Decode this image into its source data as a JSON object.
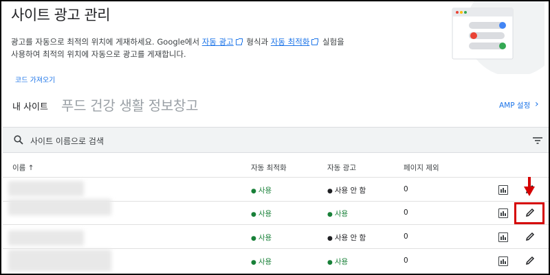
{
  "page": {
    "title": "사이트 광고 관리",
    "desc_part1": "광고를 자동으로 최적의 위치에 게재하세요. Google에서",
    "desc_link1": "자동 광고",
    "desc_part2": "형식과",
    "desc_link2": "자동 최적화",
    "desc_part3": "실험을",
    "desc_line2": "사용하여 최적의 위치에 자동으로 광고를 게재합니다.",
    "code_link": "코드 가져오기"
  },
  "mysite": {
    "label": "내 사이트",
    "site_name": "푸드 건강 생활 정보창고",
    "amp_link": "AMP 설정",
    "amp_chevron": "›"
  },
  "search": {
    "placeholder": "사이트 이름으로 검색"
  },
  "table": {
    "headers": [
      "이름 ↑",
      "자동 최적화",
      "자동 광고",
      "페이지 제외"
    ],
    "rows": [
      {
        "auto_opt": "사용",
        "auto_ads": "사용 안 함",
        "exclusions": "0"
      },
      {
        "auto_opt": "사용",
        "auto_ads": "사용",
        "exclusions": "0"
      },
      {
        "auto_opt": "사용",
        "auto_ads": "사용 안 함",
        "exclusions": "0"
      },
      {
        "auto_opt": "사용",
        "auto_ads": "사용",
        "exclusions": "0"
      }
    ]
  },
  "colors": {
    "accent": "#1a73e8",
    "status_green": "#188038",
    "highlight_red": "#d50000"
  }
}
